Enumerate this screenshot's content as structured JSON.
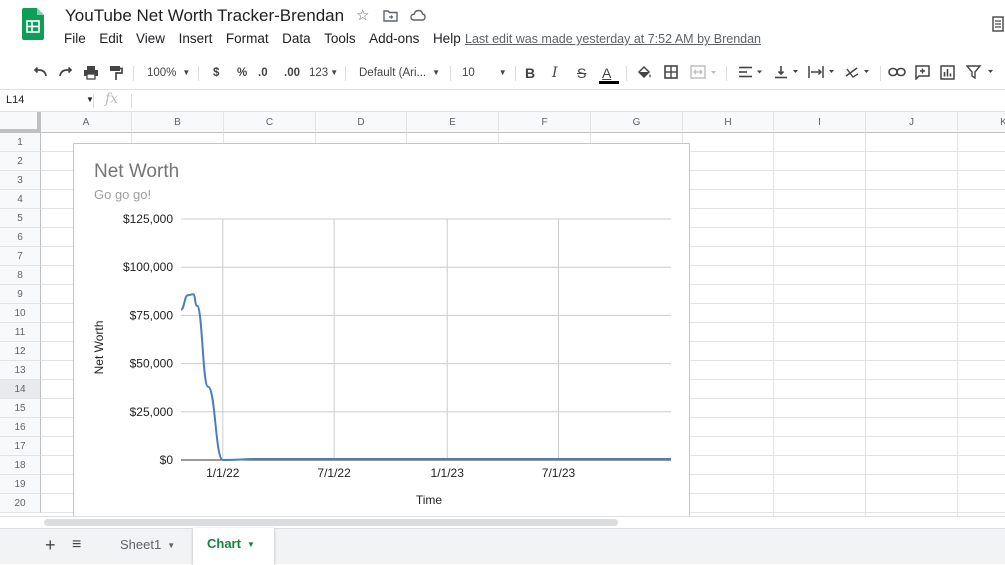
{
  "app": {
    "doc_title": "YouTube Net Worth Tracker-Brendan",
    "last_edit": "Last edit was made yesterday at 7:52 AM by Brendan",
    "brand_color": "#0F9D58"
  },
  "menu": [
    "File",
    "Edit",
    "View",
    "Insert",
    "Format",
    "Data",
    "Tools",
    "Add-ons",
    "Help"
  ],
  "toolbar": {
    "zoom": "100%",
    "currency": "$",
    "percent": "%",
    "decrease_decimal": ".0",
    "increase_decimal": ".00",
    "more_formats": "123",
    "font": "Default (Ari...",
    "font_size": "10",
    "bold": "B",
    "italic": "I",
    "strikethrough": "S",
    "text_color_letter": "A"
  },
  "formula_bar": {
    "name_box": "L14",
    "fx_label": "fx",
    "value": ""
  },
  "grid": {
    "columns": [
      "A",
      "B",
      "C",
      "D",
      "E",
      "F",
      "G",
      "H",
      "I",
      "J",
      "K"
    ],
    "rows": [
      "1",
      "2",
      "3",
      "4",
      "5",
      "6",
      "7",
      "8",
      "9",
      "10",
      "11",
      "12",
      "13",
      "14",
      "15",
      "16",
      "17",
      "18",
      "19",
      "20"
    ],
    "selected_row": "14"
  },
  "chart_data": {
    "type": "line",
    "title": "Net Worth",
    "subtitle": "Go go go!",
    "xlabel": "Time",
    "ylabel": "Net Worth",
    "yticks": [
      "$0",
      "$25,000",
      "$50,000",
      "$75,000",
      "$100,000",
      "$125,000"
    ],
    "ylim": [
      0,
      125000
    ],
    "xticks": [
      "1/1/22",
      "7/1/22",
      "1/1/23",
      "7/1/23"
    ],
    "xlim": [
      "2021-10-25",
      "2023-12-31"
    ],
    "grid": true,
    "series_color": "#4a7ebb",
    "series": [
      {
        "x": [
          "2021-10-25",
          "2021-11-05",
          "2021-11-14",
          "2021-11-20",
          "2021-12-08",
          "2022-01-01",
          "2022-03-01",
          "2023-06-01",
          "2023-12-31"
        ],
        "values": [
          78000,
          85500,
          86000,
          80000,
          38000,
          0,
          500,
          500,
          500
        ]
      }
    ]
  },
  "sheets": {
    "add_sheet": "+",
    "all_sheets": "≡",
    "tabs": [
      {
        "label": "Sheet1",
        "active": false
      },
      {
        "label": "Chart",
        "active": true
      }
    ]
  }
}
